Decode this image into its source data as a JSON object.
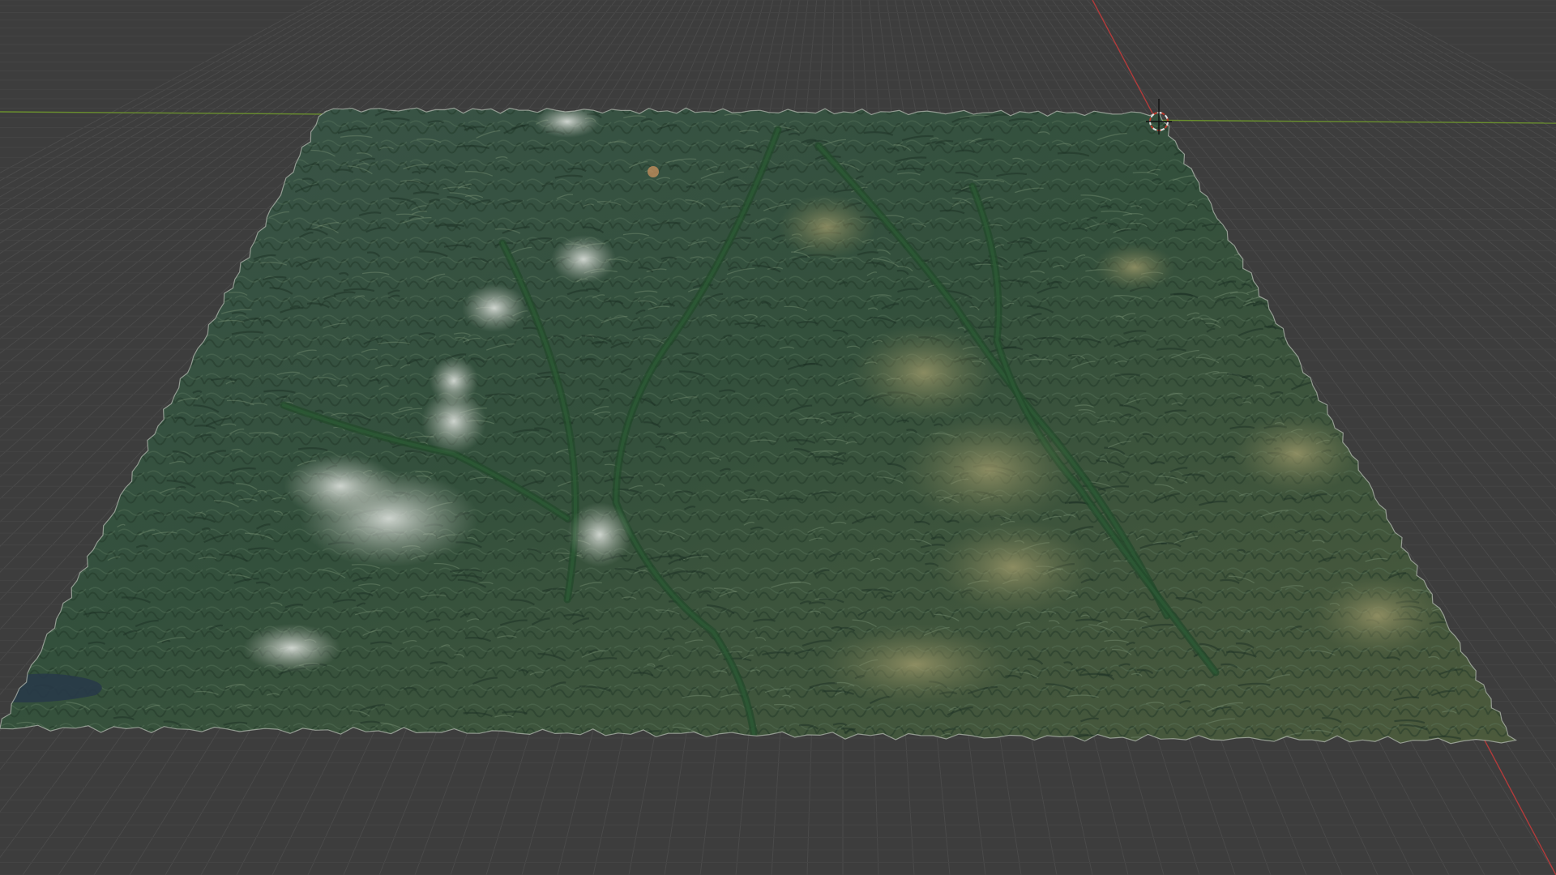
{
  "viewport": {
    "background_color": "#3d3d3d",
    "grid_color": "#4a4a4a",
    "grid_minor_color": "#444444",
    "x_axis_color": "#b33b3b",
    "y_axis_color": "#6a8f2e",
    "cursor_color": "#e0e0e0",
    "cursor_accent_color": "#c0392b"
  },
  "terrain": {
    "base_color": "#2f4a3a",
    "forest_color": "#2d5a36",
    "ridge_light_color": "#7f8f72",
    "snow_color": "#c9cfc9",
    "valley_color": "#234a2b",
    "water_color": "#283a48",
    "edge_color": "#b9c0b7"
  },
  "icons": {
    "cursor": "3d-cursor-icon"
  }
}
